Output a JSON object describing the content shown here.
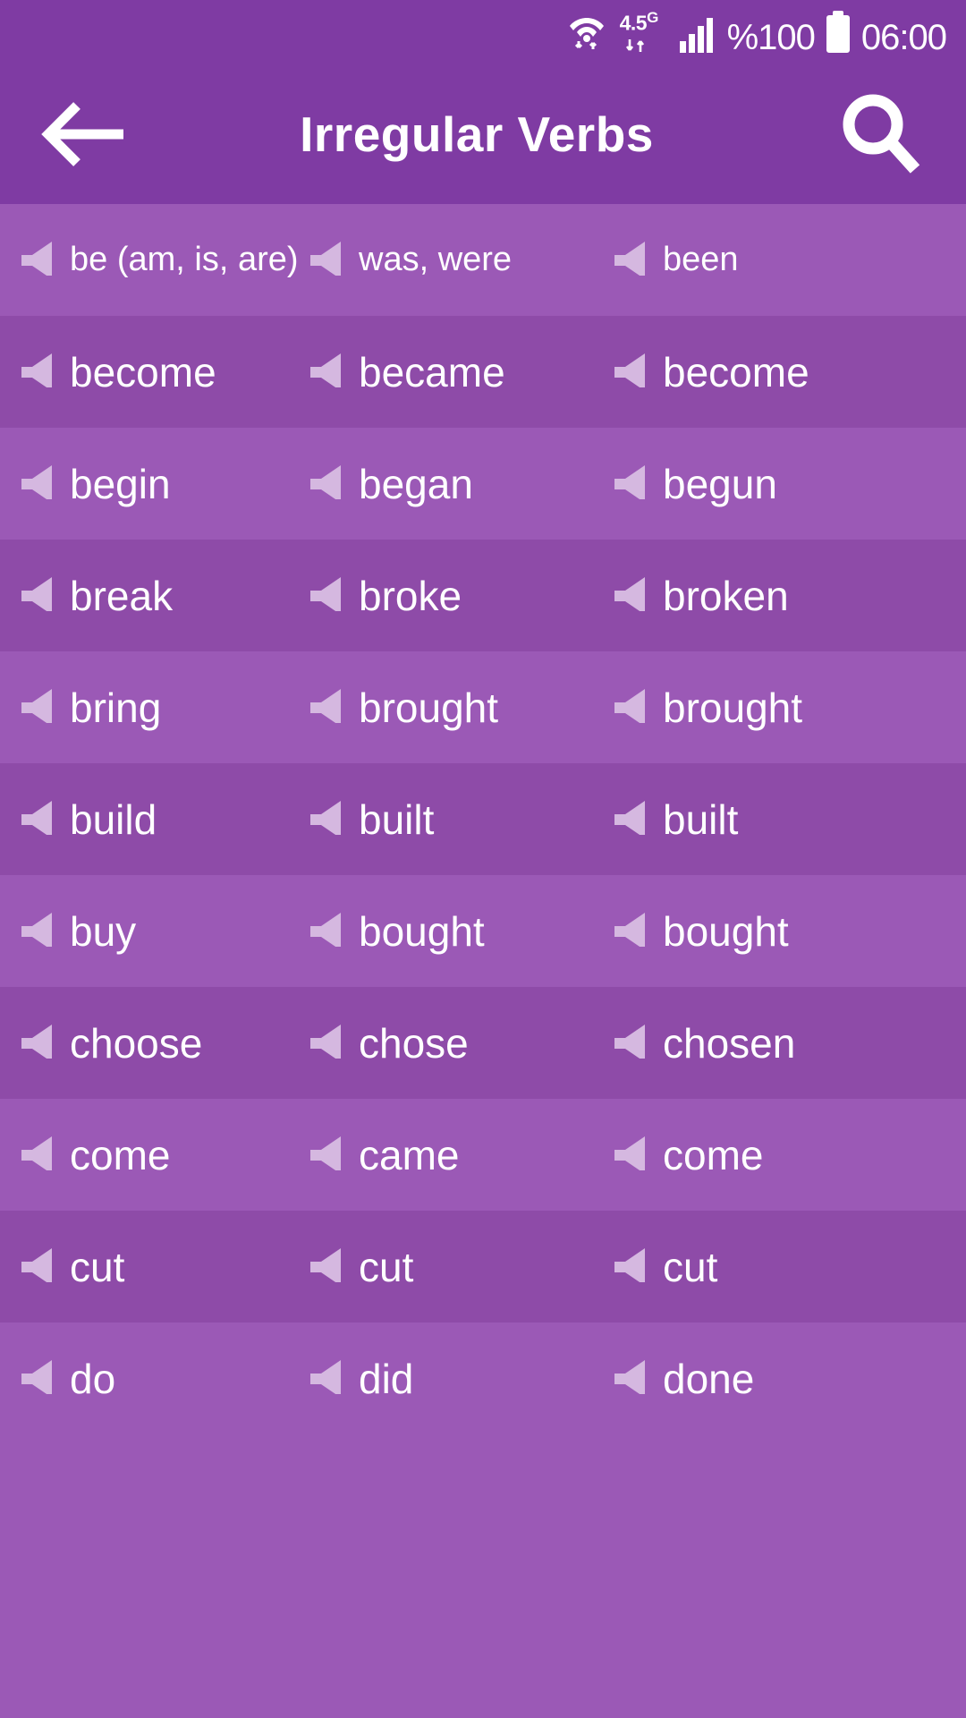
{
  "status_bar": {
    "wifi_icon": "wifi-icon",
    "network_label": "4.5",
    "network_suffix": "G",
    "signal_icon": "signal-bars-icon",
    "battery_percent": "%100",
    "battery_icon": "battery-full-icon",
    "clock": "06:00"
  },
  "app_bar": {
    "back_icon": "back-arrow-icon",
    "title": "Irregular Verbs",
    "search_icon": "search-icon"
  },
  "colors": {
    "header": "#7f3ba3",
    "row_light": "#9b59b6",
    "row_dark": "#8e4ba8",
    "text": "#ffffff",
    "speaker": "#d5b8e0"
  },
  "verbs": [
    {
      "base": "be (am, is, are)",
      "past": "was, were",
      "participle": "been",
      "small": true
    },
    {
      "base": "become",
      "past": "became",
      "participle": "become",
      "small": false
    },
    {
      "base": "begin",
      "past": "began",
      "participle": "begun",
      "small": false
    },
    {
      "base": "break",
      "past": "broke",
      "participle": "broken",
      "small": false
    },
    {
      "base": "bring",
      "past": "brought",
      "participle": "brought",
      "small": false
    },
    {
      "base": "build",
      "past": "built",
      "participle": "built",
      "small": false
    },
    {
      "base": "buy",
      "past": "bought",
      "participle": "bought",
      "small": false
    },
    {
      "base": "choose",
      "past": "chose",
      "participle": "chosen",
      "small": false
    },
    {
      "base": "come",
      "past": "came",
      "participle": "come",
      "small": false
    },
    {
      "base": "cut",
      "past": "cut",
      "participle": "cut",
      "small": false
    },
    {
      "base": "do",
      "past": "did",
      "participle": "done",
      "small": false
    }
  ]
}
